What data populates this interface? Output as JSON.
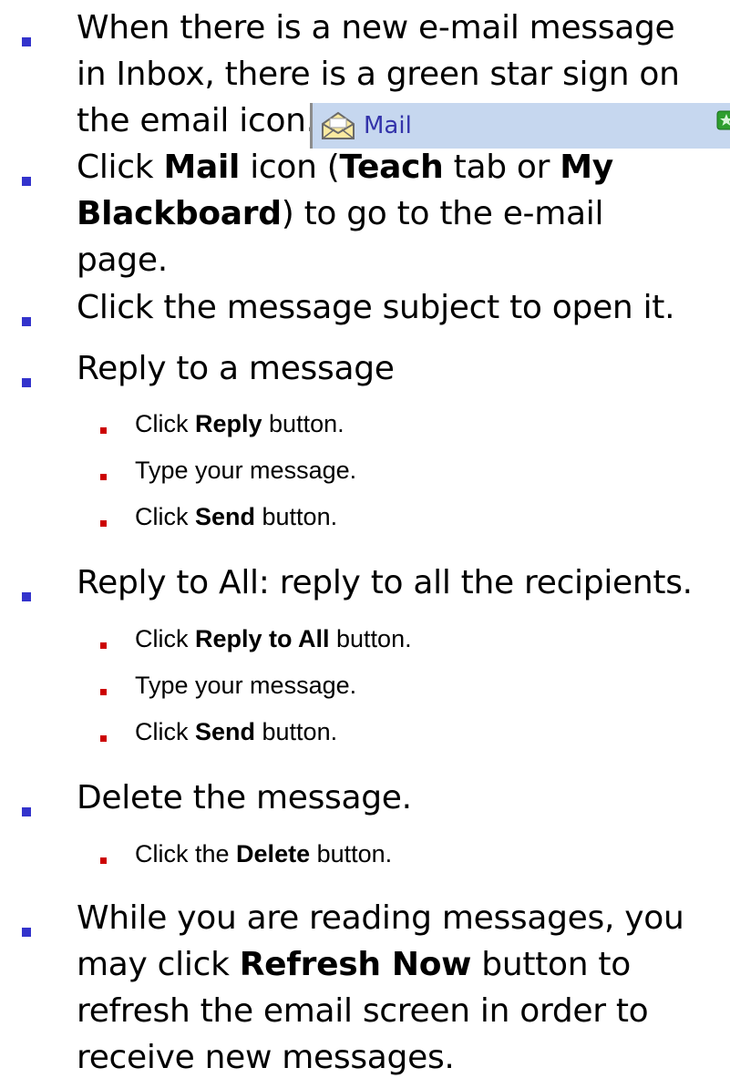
{
  "bullets": [
    {
      "lines": [
        [
          {
            "t": "When there is a new e-mail message",
            "b": false
          }
        ],
        [
          {
            "t": "in Inbox, there is a green star sign on",
            "b": false
          }
        ],
        [
          {
            "t": "the email icon.",
            "b": false
          }
        ]
      ]
    },
    {
      "lines": [
        [
          {
            "t": "Click ",
            "b": false
          },
          {
            "t": "Mail",
            "b": true
          },
          {
            "t": " icon (",
            "b": false
          },
          {
            "t": "Teach",
            "b": true
          },
          {
            "t": " tab or ",
            "b": false
          },
          {
            "t": "My",
            "b": true
          }
        ],
        [
          {
            "t": "Blackboard",
            "b": true
          },
          {
            "t": ") to go to the e-mail",
            "b": false
          }
        ],
        [
          {
            "t": "page.",
            "b": false
          }
        ]
      ]
    },
    {
      "lines": [
        [
          {
            "t": "Click the message subject to open it.",
            "b": false
          }
        ]
      ]
    },
    {
      "lines": [
        [
          {
            "t": "Reply to a message",
            "b": false
          }
        ]
      ],
      "sub": [
        [
          {
            "t": "Click ",
            "b": false
          },
          {
            "t": "Reply",
            "b": true
          },
          {
            "t": " button.",
            "b": false
          }
        ],
        [
          {
            "t": "Type your message.",
            "b": false
          }
        ],
        [
          {
            "t": "Click ",
            "b": false
          },
          {
            "t": "Send",
            "b": true
          },
          {
            "t": " button.",
            "b": false
          }
        ]
      ]
    },
    {
      "lines": [
        [
          {
            "t": "Reply to All: reply to all the recipients.",
            "b": false
          }
        ]
      ],
      "sub": [
        [
          {
            "t": "Click ",
            "b": false
          },
          {
            "t": "Reply to All",
            "b": true
          },
          {
            "t": " button.",
            "b": false
          }
        ],
        [
          {
            "t": "Type your message.",
            "b": false
          }
        ],
        [
          {
            "t": "Click ",
            "b": false
          },
          {
            "t": "Send",
            "b": true
          },
          {
            "t": " button.",
            "b": false
          }
        ]
      ]
    },
    {
      "lines": [
        [
          {
            "t": "Delete the message.",
            "b": false
          }
        ]
      ],
      "sub": [
        [
          {
            "t": "Click the ",
            "b": false
          },
          {
            "t": "Delete",
            "b": true
          },
          {
            "t": " button.",
            "b": false
          }
        ]
      ]
    },
    {
      "lines": [
        [
          {
            "t": "While you are reading messages, you",
            "b": false
          }
        ],
        [
          {
            "t": "may click ",
            "b": false
          },
          {
            "t": "Refresh Now",
            "b": true
          },
          {
            "t": "  button to",
            "b": false
          }
        ],
        [
          {
            "t": "refresh the email screen in order to",
            "b": false
          }
        ],
        [
          {
            "t": "receive new messages.",
            "b": false
          }
        ]
      ]
    }
  ],
  "mail_widget": {
    "label": "Mail",
    "envelope_icon": "envelope-icon",
    "star_icon": "green-star-icon",
    "bar_color": "#c6d7ef",
    "star_color": "#2e9e2e"
  },
  "colors": {
    "main_bullet": "#3333cc",
    "sub_bullet": "#cc0000",
    "mail_label": "#3333aa"
  }
}
